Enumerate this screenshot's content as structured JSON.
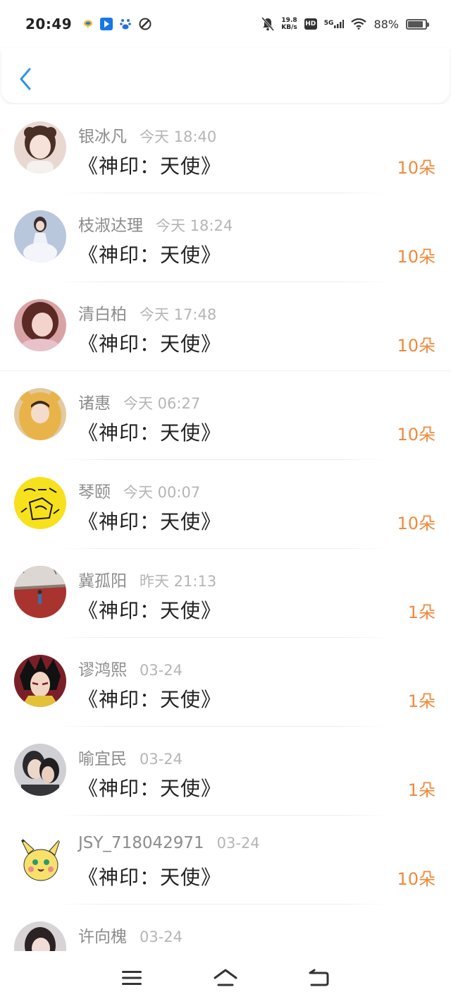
{
  "status_bar": {
    "time": "20:49",
    "net_speed_value": "19.8",
    "net_speed_unit": "KB/s",
    "hd": "HD",
    "network": "5G",
    "battery": "88%",
    "battery_level": 0.88
  },
  "header": {
    "back_icon": "chevron-left-icon",
    "accent_color": "#2c96e6"
  },
  "colors": {
    "gift_count": "#ef8a3c",
    "name": "#8c8c8c",
    "time": "#b5b5b5"
  },
  "gifts": [
    {
      "name": "银冰凡",
      "time": "今天 18:40",
      "gift": "《神印：天使》",
      "count": "10朵"
    },
    {
      "name": "枝淑达理",
      "time": "今天 18:24",
      "gift": "《神印：天使》",
      "count": "10朵"
    },
    {
      "name": "清白柏",
      "time": "今天 17:48",
      "gift": "《神印：天使》",
      "count": "10朵"
    },
    {
      "name": "诸惠",
      "time": "今天 06:27",
      "gift": "《神印：天使》",
      "count": "10朵"
    },
    {
      "name": "琴颐",
      "time": "今天 00:07",
      "gift": "《神印：天使》",
      "count": "10朵"
    },
    {
      "name": "冀孤阳",
      "time": "昨天 21:13",
      "gift": "《神印：天使》",
      "count": "1朵"
    },
    {
      "name": "谬鸿熙",
      "time": "03-24",
      "gift": "《神印：天使》",
      "count": "1朵"
    },
    {
      "name": "喻宜民",
      "time": "03-24",
      "gift": "《神印：天使》",
      "count": "1朵"
    },
    {
      "name": "JSY_718042971",
      "time": "03-24",
      "gift": "《神印：天使》",
      "count": "10朵"
    },
    {
      "name": "许向槐",
      "time": "03-24",
      "gift": "",
      "count": ""
    }
  ],
  "bottom_nav": {
    "menu_icon": "menu-icon",
    "home_icon": "home-icon",
    "back_icon": "back-icon"
  }
}
